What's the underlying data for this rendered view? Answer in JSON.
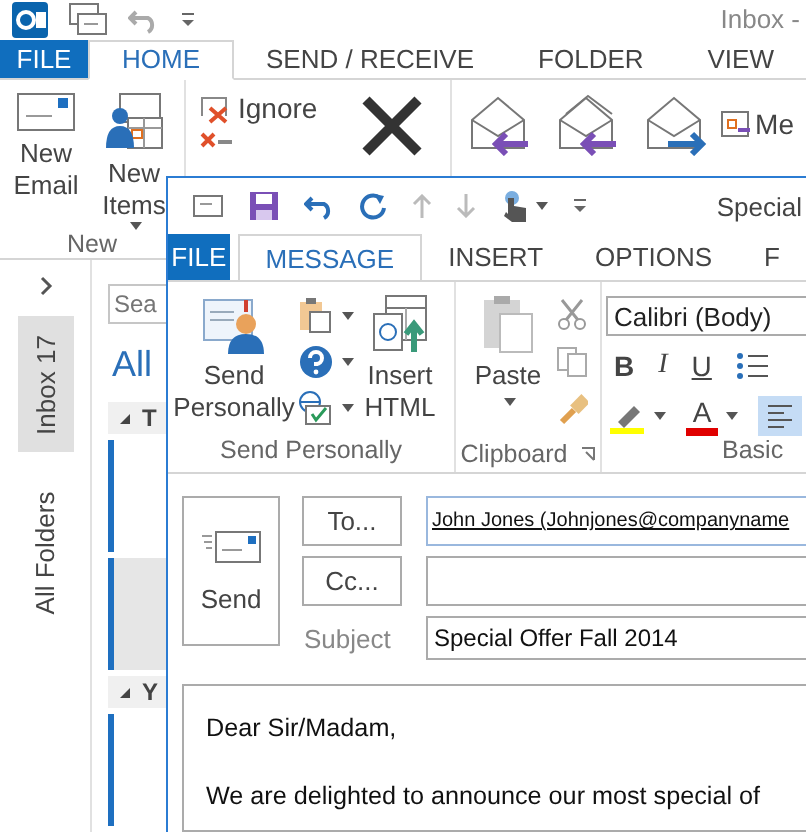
{
  "main_window": {
    "title": "Inbox -",
    "tabs": [
      {
        "label": "FILE",
        "kind": "file",
        "selected": false
      },
      {
        "label": "HOME",
        "kind": "tab",
        "selected": true
      },
      {
        "label": "SEND / RECEIVE",
        "kind": "tab",
        "selected": false
      },
      {
        "label": "FOLDER",
        "kind": "tab",
        "selected": false
      },
      {
        "label": "VIEW",
        "kind": "tab",
        "selected": false
      }
    ],
    "new_group": {
      "label": "New",
      "buttons": [
        {
          "label": "New Email",
          "dropdown": false
        },
        {
          "label": "New Items",
          "dropdown": true
        }
      ]
    },
    "delete_group": {
      "commands": [
        "Ignore"
      ]
    },
    "respond_group": {
      "commands": [
        "Me"
      ]
    },
    "navigation": {
      "folders": [
        {
          "label": "Inbox",
          "count": "17",
          "selected": true
        },
        {
          "label": "All Folders",
          "selected": false
        }
      ]
    },
    "message_list": {
      "search": {
        "placeholder": "Sea"
      },
      "filter": "All",
      "groups": [
        {
          "label": "T",
          "messages": [
            {
              "selected": false
            },
            {
              "selected": true
            }
          ]
        },
        {
          "label": "Y",
          "messages": [
            {
              "selected": false
            }
          ]
        }
      ]
    }
  },
  "compose_window": {
    "title": "Special",
    "tabs": [
      {
        "label": "FILE",
        "kind": "file",
        "selected": false
      },
      {
        "label": "MESSAGE",
        "kind": "tab",
        "selected": true
      },
      {
        "label": "INSERT",
        "kind": "tab",
        "selected": false
      },
      {
        "label": "OPTIONS",
        "kind": "tab",
        "selected": false
      },
      {
        "label": "F",
        "kind": "tab",
        "selected": false
      }
    ],
    "send_personally_group": {
      "label": "Send Personally",
      "buttons": [
        "Send Personally",
        "Insert HTML"
      ]
    },
    "clipboard_group": {
      "label": "Clipboard",
      "paste": "Paste"
    },
    "basic_text_group": {
      "label": "Basic",
      "font": "Calibri (Body)",
      "styles": [
        "B",
        "I",
        "U"
      ],
      "font_color_letter": "A",
      "align_left": true
    },
    "send": "Send",
    "to_button": "To...",
    "cc_button": "Cc...",
    "subject_label": "Subject",
    "to": "John Jones (Johnjones@companyname",
    "subject": "Special Offer Fall 2014",
    "body": [
      "Dear Sir/Madam,",
      "We are delighted to announce our most special of"
    ]
  }
}
